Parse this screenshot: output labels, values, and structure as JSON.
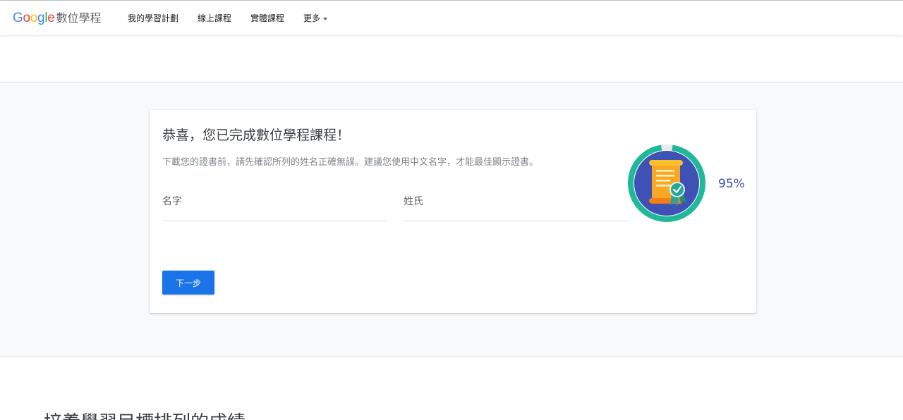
{
  "header": {
    "logo_word": "Google",
    "logo_product": "數位學程",
    "nav": [
      {
        "label": "我的學習計劃"
      },
      {
        "label": "線上課程"
      },
      {
        "label": "實體課程"
      },
      {
        "label": "更多"
      }
    ]
  },
  "card": {
    "title": "恭喜，您已完成數位學程課程！",
    "description": "下載您的證書前，請先確認所列的姓名正確無誤。建議您使用中文名字，才能最佳顯示證書。",
    "first_name_label": "名字",
    "last_name_label": "姓氏",
    "first_name_value": "",
    "last_name_value": "",
    "next_button": "下一步",
    "progress_percent": 95,
    "progress_label": "95%"
  },
  "bottom": {
    "heading": "培養學習目標排列的成績"
  },
  "colors": {
    "accent_blue": "#1a73e8",
    "ring_teal": "#1fb99a",
    "badge_navy": "#3f51b5",
    "scroll_orange": "#f9a825",
    "percent_text": "#3949ab"
  }
}
